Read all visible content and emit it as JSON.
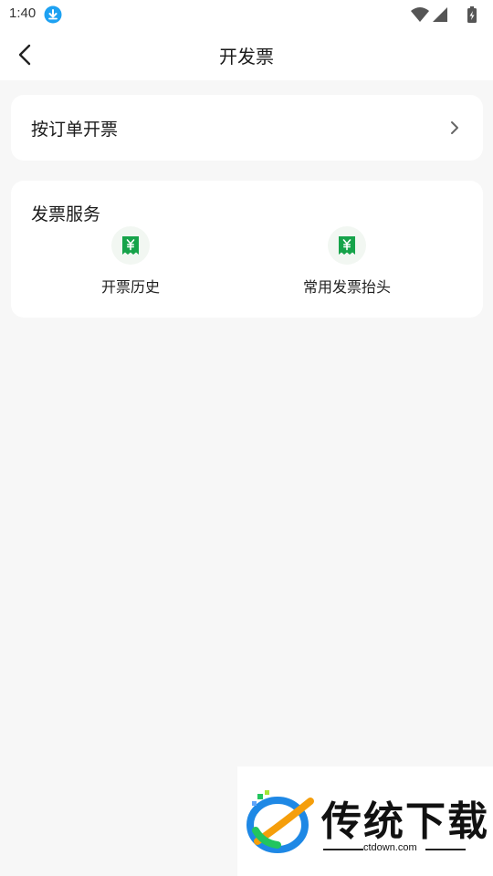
{
  "status_bar": {
    "time": "1:40",
    "icons": [
      "download-notification-icon",
      "wifi-icon",
      "signal-icon",
      "battery-charging-icon"
    ]
  },
  "nav": {
    "title": "开发票",
    "back_icon": "chevron-left-icon"
  },
  "order_card": {
    "label": "按订单开票",
    "chevron_icon": "chevron-right-icon"
  },
  "services": {
    "title": "发票服务",
    "items": [
      {
        "label": "开票历史",
        "icon": "invoice-yuan-icon"
      },
      {
        "label": "常用发票抬头",
        "icon": "invoice-yuan-icon"
      }
    ],
    "icon_color": "#16a34a"
  },
  "watermark": {
    "brand": "传统下载",
    "url": "ctdown.com"
  },
  "colors": {
    "background": "#f7f7f7",
    "card": "#ffffff",
    "accent_green": "#16a34a"
  }
}
